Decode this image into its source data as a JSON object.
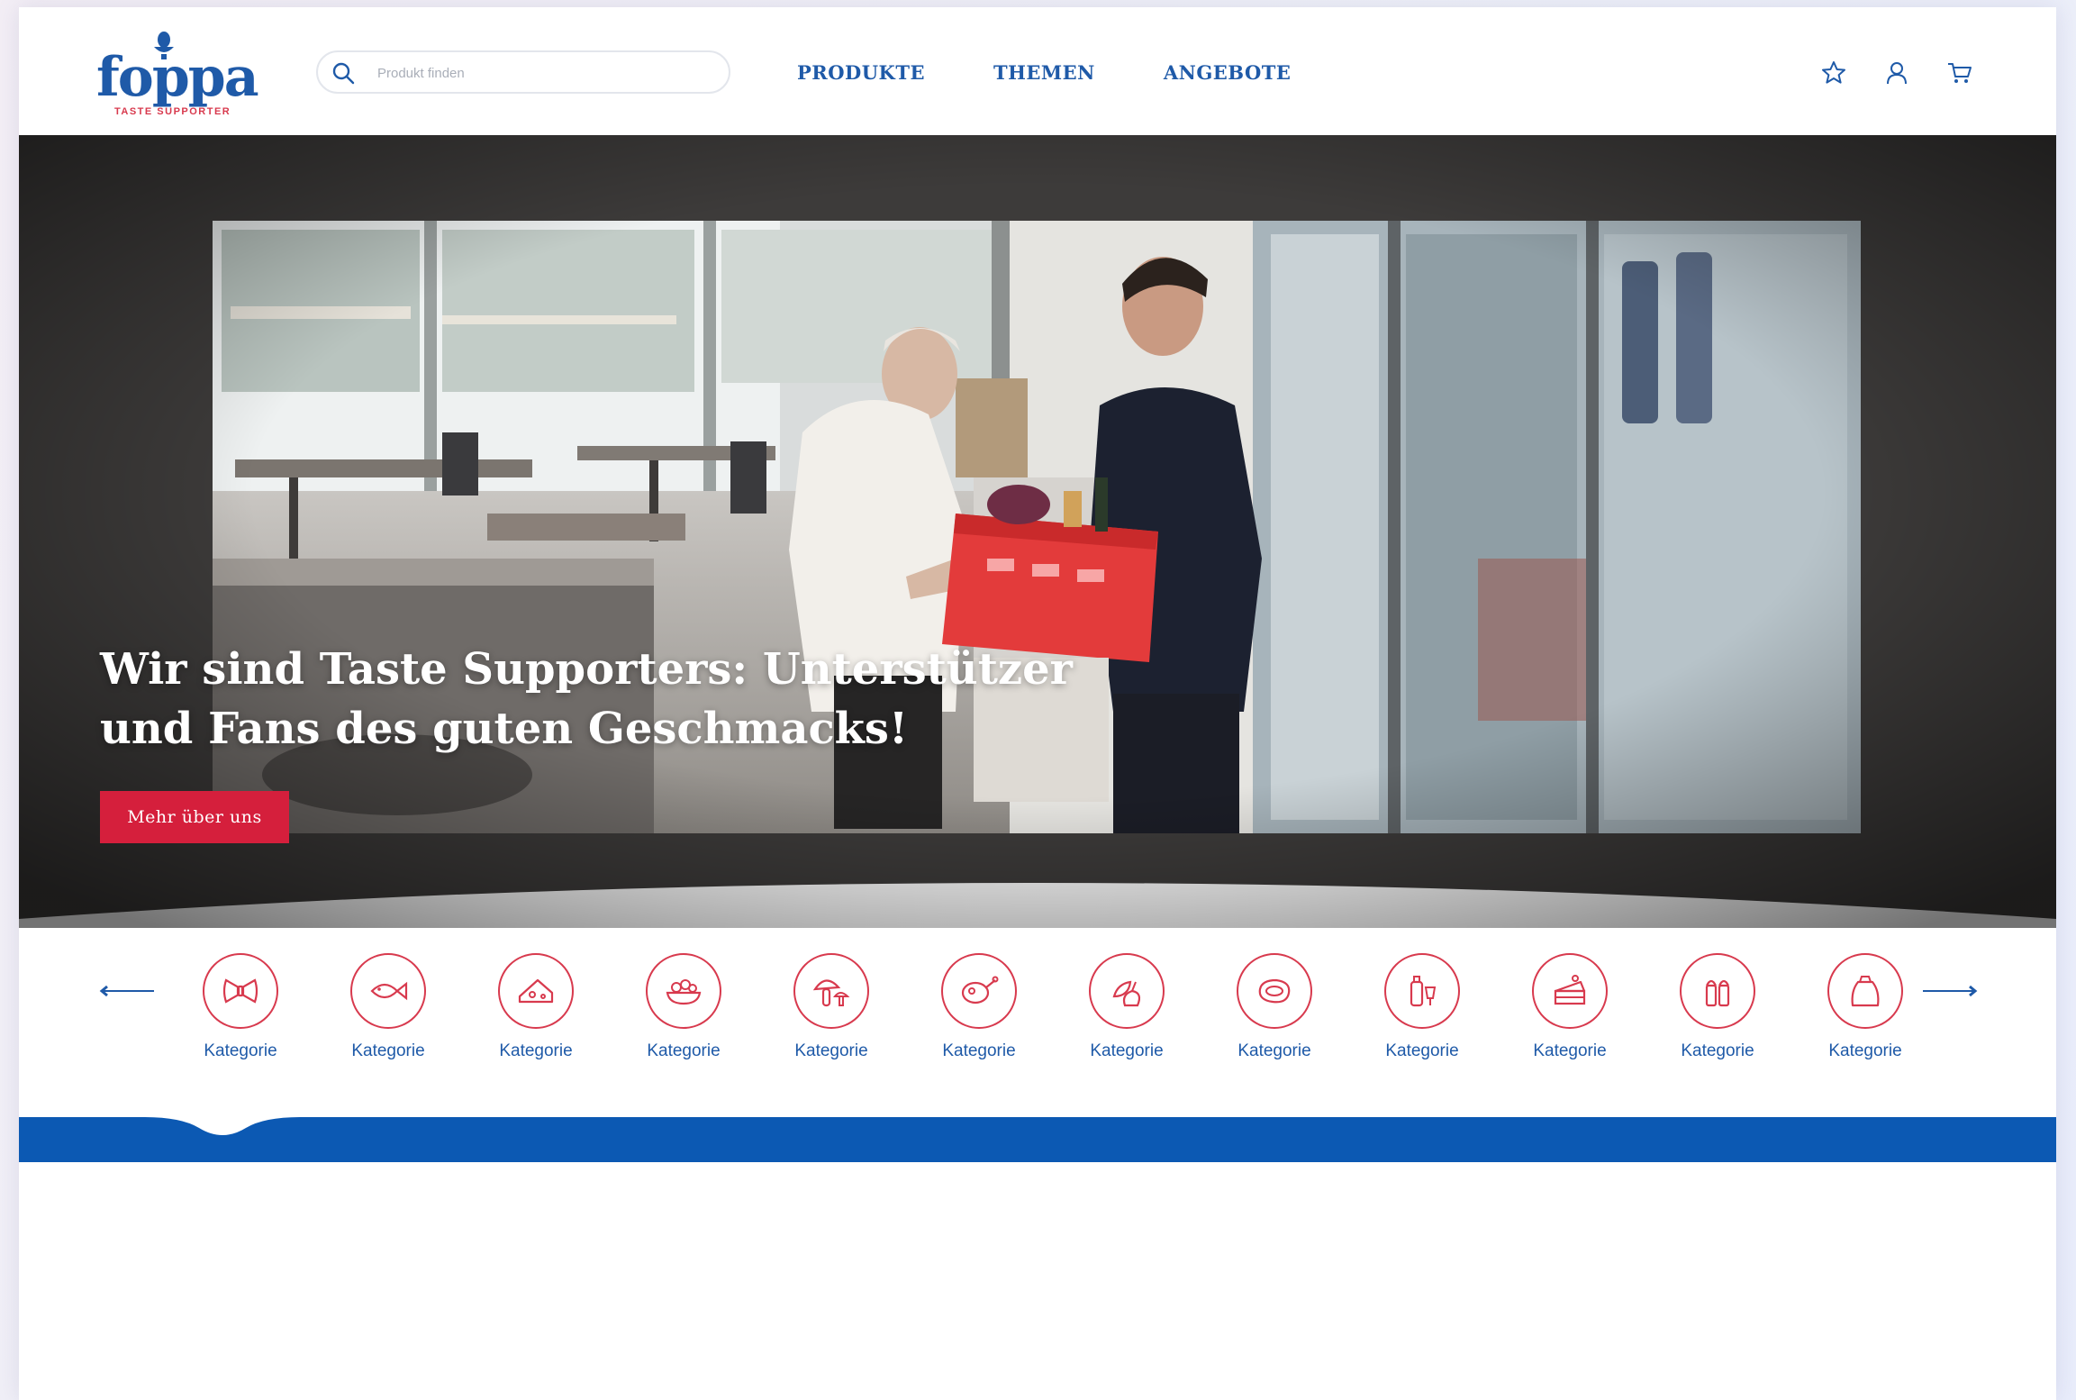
{
  "brand": {
    "name": "foppa",
    "tagline": "TASTE SUPPORTER",
    "primary_color": "#1f5aa8",
    "accent_color": "#d51f3c"
  },
  "header": {
    "search": {
      "placeholder": "Produkt finden",
      "value": "",
      "icon": "search-icon"
    },
    "nav": [
      "PRODUKTE",
      "THEMEN",
      "ANGEBOTE"
    ],
    "icons": [
      "star-icon",
      "user-icon",
      "cart-icon"
    ]
  },
  "hero": {
    "title": "Wir sind Taste Supporters: Unterstützer und Fans des guten Geschmacks!",
    "cta_label": "Mehr über uns"
  },
  "categories": {
    "items": [
      {
        "label": "Kategorie",
        "icon": "pasta-icon"
      },
      {
        "label": "Kategorie",
        "icon": "fish-icon"
      },
      {
        "label": "Kategorie",
        "icon": "cheese-icon"
      },
      {
        "label": "Kategorie",
        "icon": "salad-bowl-icon"
      },
      {
        "label": "Kategorie",
        "icon": "mushroom-icon"
      },
      {
        "label": "Kategorie",
        "icon": "chicken-icon"
      },
      {
        "label": "Kategorie",
        "icon": "vegetables-icon"
      },
      {
        "label": "Kategorie",
        "icon": "steak-icon"
      },
      {
        "label": "Kategorie",
        "icon": "drinks-icon"
      },
      {
        "label": "Kategorie",
        "icon": "cake-icon"
      },
      {
        "label": "Kategorie",
        "icon": "salt-pepper-icon"
      },
      {
        "label": "Kategorie",
        "icon": "flour-sack-icon"
      }
    ],
    "prev_icon": "arrow-left-icon",
    "next_icon": "arrow-right-icon"
  }
}
